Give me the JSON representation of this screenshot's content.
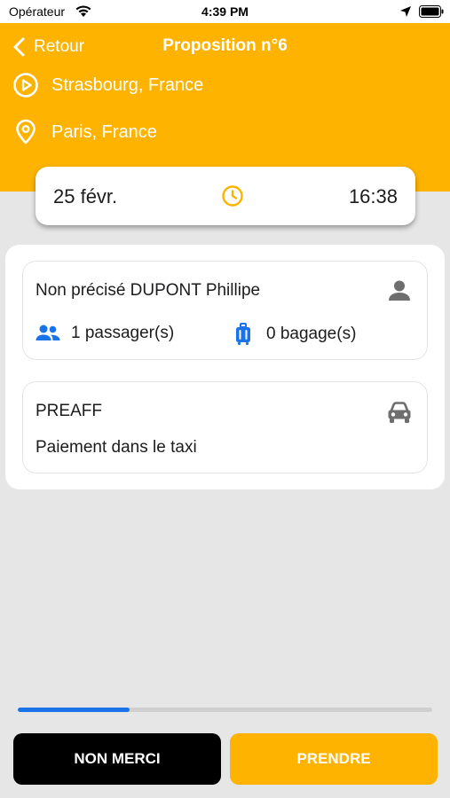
{
  "status_bar": {
    "carrier": "Opérateur",
    "time": "4:39 PM"
  },
  "header": {
    "back_label": "Retour",
    "title": "Proposition n°6",
    "origin": "Strasbourg, France",
    "destination": "Paris, France",
    "background_color": "#fdb300"
  },
  "schedule": {
    "date": "25 févr.",
    "time": "16:38",
    "clock_icon": "clock-icon"
  },
  "client_card": {
    "name": "Non précisé DUPONT Phillipe",
    "passengers": "1 passager(s)",
    "luggage": "0 bagage(s)",
    "icons": [
      "person-icon",
      "group-icon",
      "luggage-icon"
    ]
  },
  "payment_card": {
    "code": "PREAFF",
    "payment": "Paiement dans le taxi",
    "icons": [
      "car-icon"
    ]
  },
  "progress": {
    "value_fraction": 0.27,
    "color": "#1a73e8"
  },
  "actions": {
    "decline_label": "NON MERCI",
    "accept_label": "PRENDRE"
  }
}
